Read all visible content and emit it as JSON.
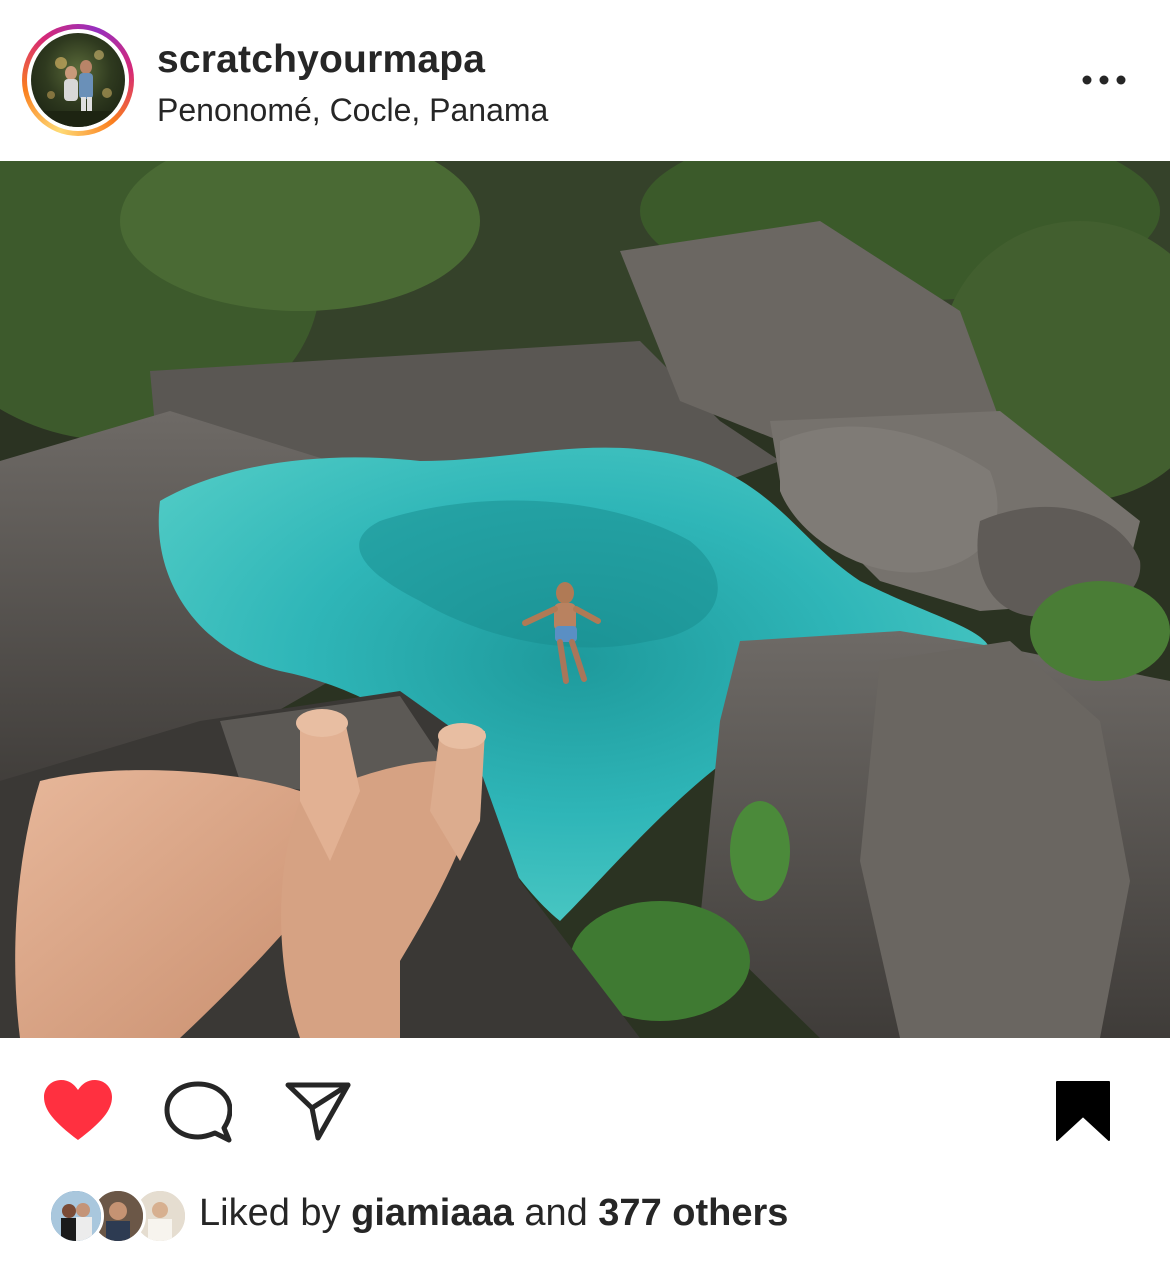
{
  "post": {
    "username": "scratchyourmapa",
    "location": "Penonomé, Cocle, Panama"
  },
  "header": {
    "more_icon": "more-horizontal-icon"
  },
  "photo": {
    "description_icon": "post-photo"
  },
  "actions": {
    "like_icon": "heart-filled-icon",
    "like_color": "#ff3040",
    "comment_icon": "comment-icon",
    "share_icon": "send-icon",
    "save_icon": "bookmark-filled-icon"
  },
  "likes": {
    "prefix": "Liked by",
    "first_liker": "giamiaaa",
    "connector": "and",
    "others": "377 others"
  }
}
